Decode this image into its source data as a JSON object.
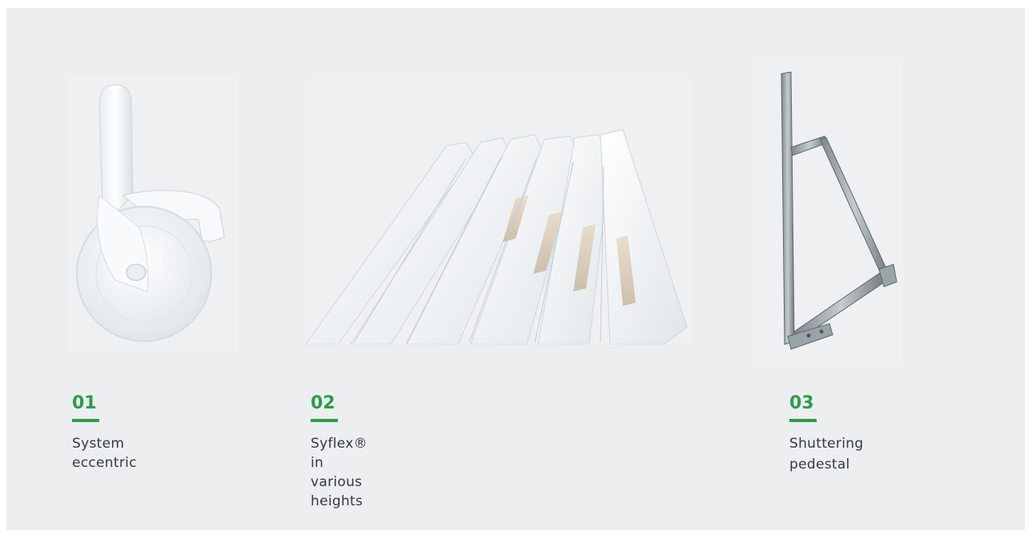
{
  "products": [
    {
      "number": "01",
      "label": "System eccentric",
      "image": "system-eccentric-photo"
    },
    {
      "number": "02",
      "label": "Syflex® in various heights",
      "image": "syflex-profiles-photo"
    },
    {
      "number": "03",
      "label_lines": [
        "Shuttering",
        "pedestal"
      ],
      "image": "shuttering-pedestal-photo"
    }
  ],
  "colors": {
    "accent": "#2a9e49",
    "panel_background": "#eceef0",
    "label_text": "#333a40"
  }
}
